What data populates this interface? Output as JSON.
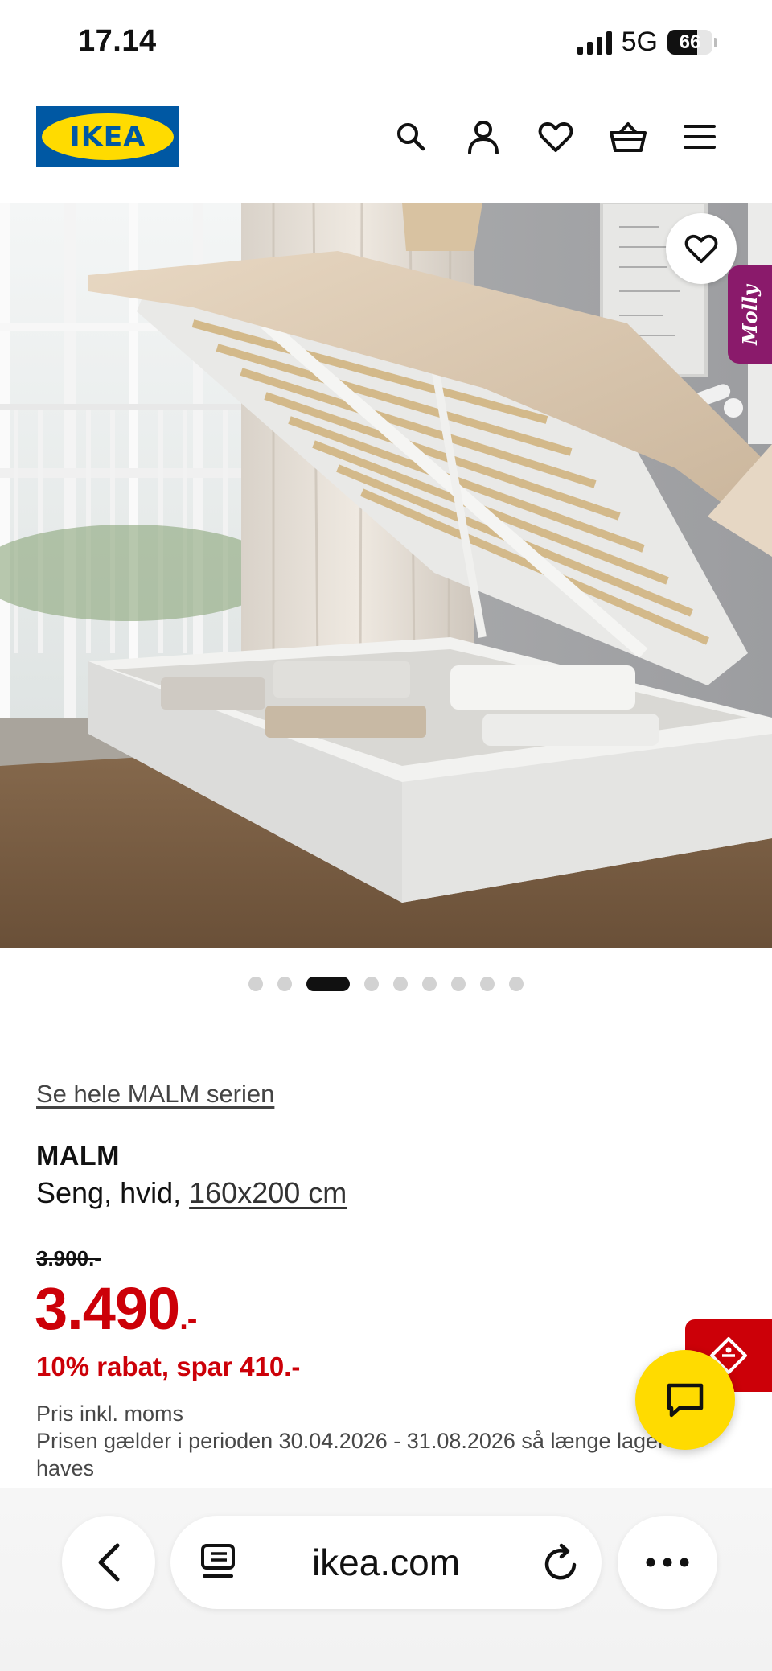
{
  "status": {
    "time": "17.14",
    "network": "5G",
    "battery": "66",
    "battery_level": 0.66
  },
  "header": {
    "logo_text": "IKEA",
    "icons": [
      "search-icon",
      "account-icon",
      "heart-icon",
      "basket-icon",
      "menu-icon"
    ]
  },
  "gallery": {
    "image_count": 9,
    "active_index": 2,
    "badge": "Molly"
  },
  "product": {
    "series_link": "Se hele MALM serien",
    "name": "MALM",
    "desc_prefix": "Seng, hvid, ",
    "size": "160x200 cm",
    "old_price": "3.900.-",
    "price": "3.490",
    "price_suffix": ".-",
    "discount": "10% rabat, spar 410.-",
    "vat_note": "Pris inkl. moms",
    "period_note": "Prisen gælder i perioden 30.04.2026 - 31.08.2026 så længe lager haves"
  },
  "browser": {
    "url": "ikea.com"
  },
  "colors": {
    "brand_blue": "#0058a3",
    "brand_yellow": "#ffdb00",
    "price_red": "#cc0008",
    "molly_purple": "#8a1a6b"
  }
}
